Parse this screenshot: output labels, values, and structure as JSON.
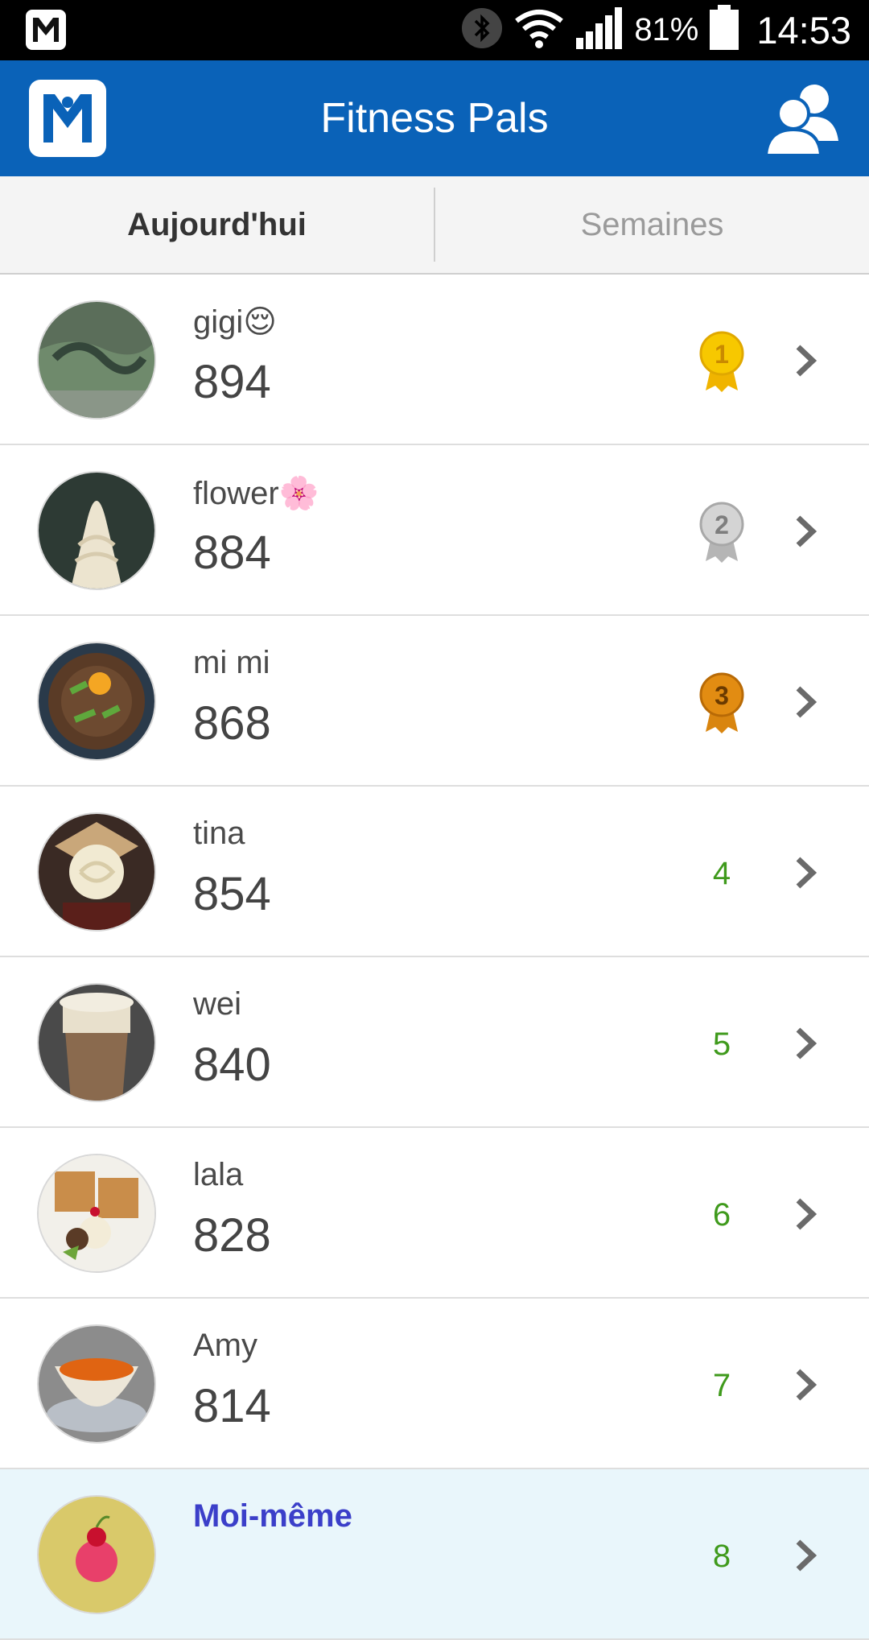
{
  "status_bar": {
    "battery_pct": "81%",
    "time": "14:53",
    "icons": [
      "app-notification-icon",
      "bluetooth-icon",
      "wifi-icon",
      "signal-icon",
      "battery-icon"
    ]
  },
  "header": {
    "title": "Fitness Pals",
    "logo_icon": "app-logo-icon",
    "friends_icon": "friends-icon",
    "bg_color": "#0a62b8"
  },
  "tabs": [
    {
      "label": "Aujourd'hui",
      "active": true
    },
    {
      "label": "Semaines",
      "active": false
    }
  ],
  "rankings": [
    {
      "name": "gigi",
      "emoji": "😌",
      "score": "894",
      "rank": "1",
      "medal": "gold"
    },
    {
      "name": "flower",
      "emoji": "🌸",
      "score": "884",
      "rank": "2",
      "medal": "silver"
    },
    {
      "name": "mi mi",
      "emoji": "",
      "score": "868",
      "rank": "3",
      "medal": "bronze"
    },
    {
      "name": "tina",
      "emoji": "",
      "score": "854",
      "rank": "4",
      "medal": ""
    },
    {
      "name": "wei",
      "emoji": "",
      "score": "840",
      "rank": "5",
      "medal": ""
    },
    {
      "name": "lala",
      "emoji": "",
      "score": "828",
      "rank": "6",
      "medal": ""
    },
    {
      "name": "Amy",
      "emoji": "",
      "score": "814",
      "rank": "7",
      "medal": ""
    },
    {
      "name": "Moi-même",
      "emoji": "",
      "score": "",
      "rank": "8",
      "medal": "",
      "is_self": true
    }
  ],
  "colors": {
    "rank_text": "#3f9a1c",
    "self_row_bg": "#e9f6fb",
    "self_name": "#3b3fc9"
  }
}
